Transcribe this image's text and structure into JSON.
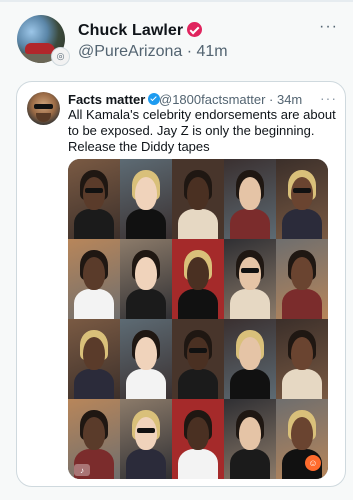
{
  "outer_post": {
    "author_name": "Chuck Lawler",
    "handle_time": "@PureArizona · 41m",
    "more_icon": "···",
    "verified_color": "#e0245e"
  },
  "quoted_post": {
    "author_name": "Facts matter",
    "meta": "@1800factsmatter · 34m",
    "more_icon": "···",
    "text_lines": [
      "All Kamala's celebrity endorsements are about",
      "to be exposed. Jay Z is only the beginning.",
      "Release the Diddy tapes"
    ],
    "verified_color": "#1d9bf0"
  },
  "collage": {
    "rows": 4,
    "cols": 5,
    "description_icon": "photo-collage",
    "watermark_icon": "tiktok-icon",
    "sticker_icon": "emoji-sticker-icon"
  }
}
